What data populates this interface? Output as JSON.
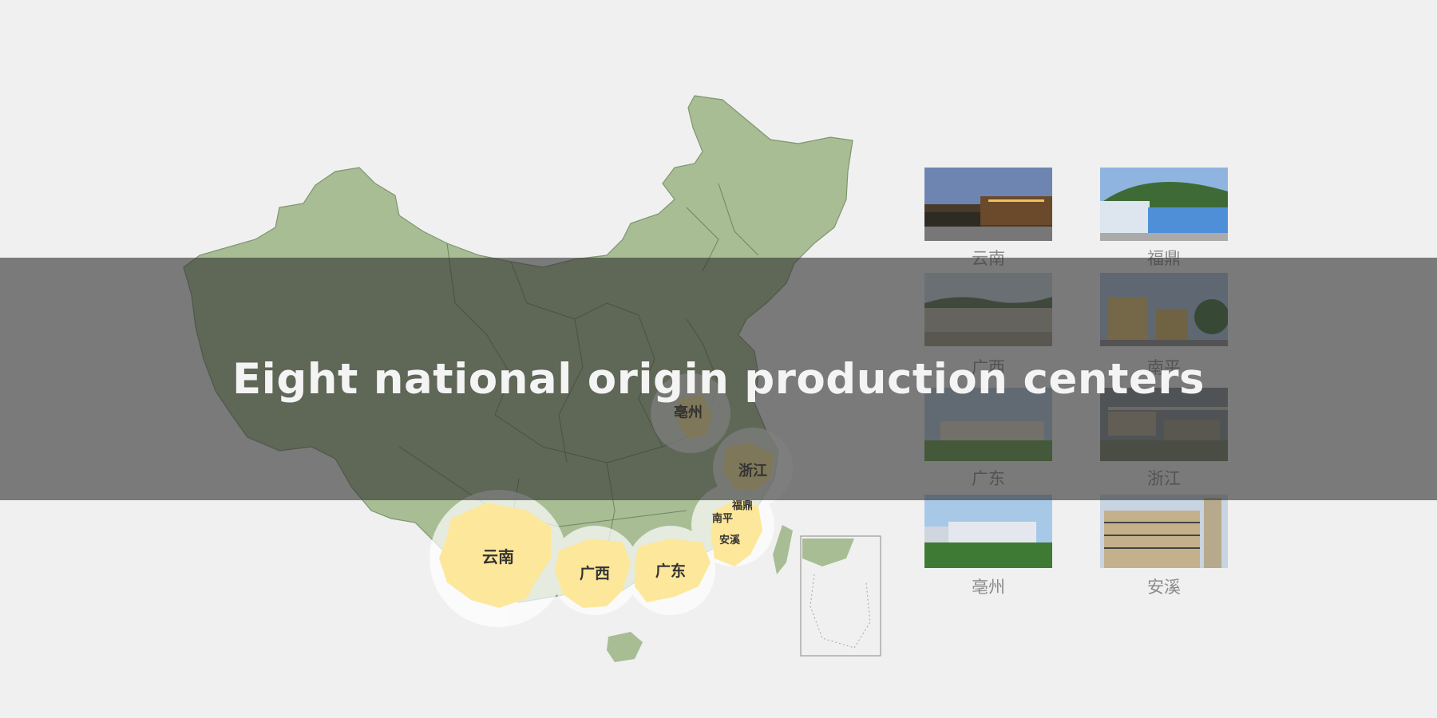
{
  "headline": "Eight national origin production centers",
  "map_regions": {
    "yunnan": "云南",
    "guangxi": "广西",
    "guangdong": "广东",
    "zhejiang": "浙江",
    "bozhou": "亳州",
    "fuding": "福鼎",
    "nanping": "南平",
    "anxi": "安溪"
  },
  "gallery": [
    {
      "caption": "云南",
      "icon": "factory-night-photo"
    },
    {
      "caption": "福鼎",
      "icon": "factory-hill-photo"
    },
    {
      "caption": "广西",
      "icon": "factory-field-photo"
    },
    {
      "caption": "南平",
      "icon": "building-photo"
    },
    {
      "caption": "广东",
      "icon": "factory-lawn-photo"
    },
    {
      "caption": "浙江",
      "icon": "aerial-factory-photo"
    },
    {
      "caption": "亳州",
      "icon": "campus-trees-photo"
    },
    {
      "caption": "安溪",
      "icon": "highrise-photo"
    }
  ],
  "colors": {
    "land": "#a8bd94",
    "highlight": "#fde79a",
    "halo": "#ffffff",
    "overlay": "rgba(50,50,50,0.62)",
    "background": "#f0f0f0"
  }
}
